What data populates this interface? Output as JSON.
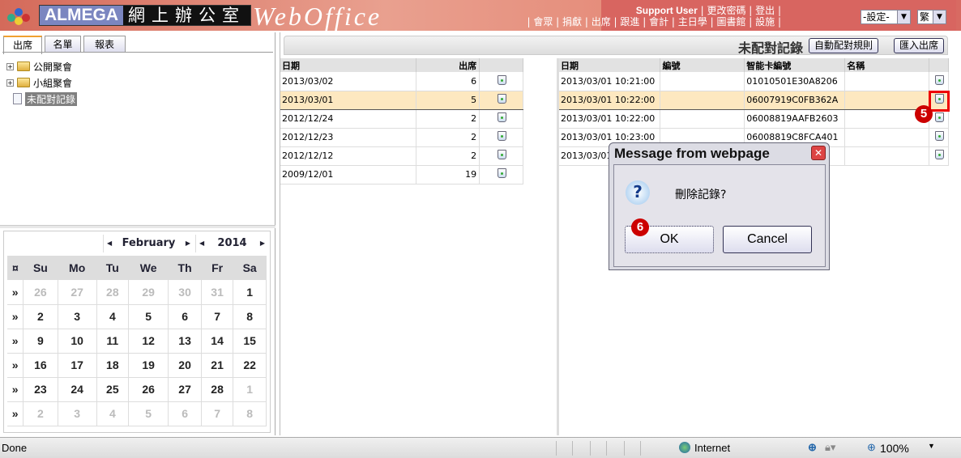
{
  "header": {
    "brand_en": "ALMEGA",
    "brand_zh": "網上辦公室",
    "product": "WebOffice",
    "user": "Support User",
    "top_links": [
      "更改密碼",
      "登出"
    ],
    "nav_links": [
      "會眾",
      "捐獻",
      "出席",
      "跟進",
      "會計",
      "主日學",
      "圖書館",
      "設施"
    ],
    "settings_select": "-設定-",
    "lang_select": "繁"
  },
  "left": {
    "tabs": [
      "出席",
      "名單",
      "報表"
    ],
    "tree": [
      "公開聚會",
      "小組聚會",
      "未配對記錄"
    ]
  },
  "calendar": {
    "month": "February",
    "year": "2014",
    "week_col": "¤",
    "week_marker": "»",
    "days": [
      "Su",
      "Mo",
      "Tu",
      "We",
      "Th",
      "Fr",
      "Sa"
    ],
    "weeks": [
      [
        "26",
        "27",
        "28",
        "29",
        "30",
        "31",
        "1"
      ],
      [
        "2",
        "3",
        "4",
        "5",
        "6",
        "7",
        "8"
      ],
      [
        "9",
        "10",
        "11",
        "12",
        "13",
        "14",
        "15"
      ],
      [
        "16",
        "17",
        "18",
        "19",
        "20",
        "21",
        "22"
      ],
      [
        "23",
        "24",
        "25",
        "26",
        "27",
        "28",
        "1"
      ],
      [
        "2",
        "3",
        "4",
        "5",
        "6",
        "7",
        "8"
      ]
    ]
  },
  "main": {
    "title": "未配對記錄",
    "auto_rule_button": "自動配對規則",
    "import_button": "匯入出席"
  },
  "dates_table": {
    "headers": [
      "日期",
      "出席"
    ],
    "rows": [
      [
        "2013/03/02",
        "6"
      ],
      [
        "2013/03/01",
        "5"
      ],
      [
        "2012/12/24",
        "2"
      ],
      [
        "2012/12/23",
        "2"
      ],
      [
        "2012/12/12",
        "2"
      ],
      [
        "2009/12/01",
        "19"
      ]
    ],
    "selected_index": 1
  },
  "records_table": {
    "headers": [
      "日期",
      "編號",
      "智能卡編號",
      "名稱"
    ],
    "rows": [
      [
        "2013/03/01 10:21:00",
        "",
        "01010501E30A8206",
        ""
      ],
      [
        "2013/03/01 10:22:00",
        "",
        "06007919C0FB362A",
        ""
      ],
      [
        "2013/03/01 10:22:00",
        "",
        "06008819AAFB2603",
        ""
      ],
      [
        "2013/03/01 10:23:00",
        "",
        "06008819C8FCA401",
        ""
      ],
      [
        "2013/03/01",
        "",
        "",
        ""
      ]
    ],
    "selected_index": 1
  },
  "annotations": {
    "step5": "5",
    "step6": "6"
  },
  "dialog": {
    "title": "Message from webpage",
    "message": "刪除記錄?",
    "ok": "OK",
    "cancel": "Cancel"
  },
  "status": {
    "text": "Done",
    "zone": "Internet",
    "zoom": "100%"
  }
}
